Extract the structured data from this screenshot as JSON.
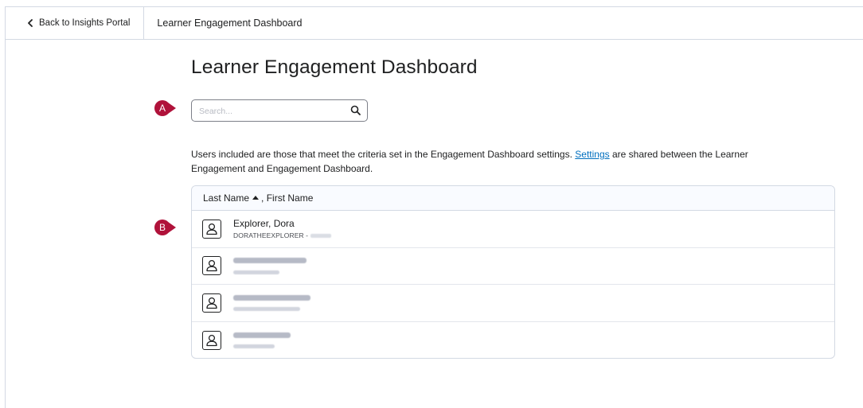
{
  "topbar": {
    "back_label": "Back to Insights Portal",
    "crumb_title": "Learner Engagement Dashboard"
  },
  "page": {
    "title": "Learner Engagement Dashboard"
  },
  "search": {
    "placeholder": "Search...",
    "value": ""
  },
  "markers": {
    "a": "A",
    "b": "B"
  },
  "info": {
    "before": "Users included are those that meet the criteria set in the Engagement Dashboard settings. ",
    "link": "Settings",
    "after": " are shared between the Learner Engagement and Engagement Dashboard."
  },
  "table": {
    "header": {
      "last_name": "Last Name",
      "first_name": ", First Name"
    },
    "rows": [
      {
        "name": "Explorer, Dora",
        "sub": "DORATHEEXPLORER -",
        "redacted": false
      },
      {
        "name": "",
        "sub": "",
        "redacted": true
      },
      {
        "name": "",
        "sub": "",
        "redacted": true
      },
      {
        "name": "",
        "sub": "",
        "redacted": true
      }
    ]
  },
  "colors": {
    "marker": "#b0123a",
    "link": "#006fbf",
    "border": "#d3d9e3"
  }
}
